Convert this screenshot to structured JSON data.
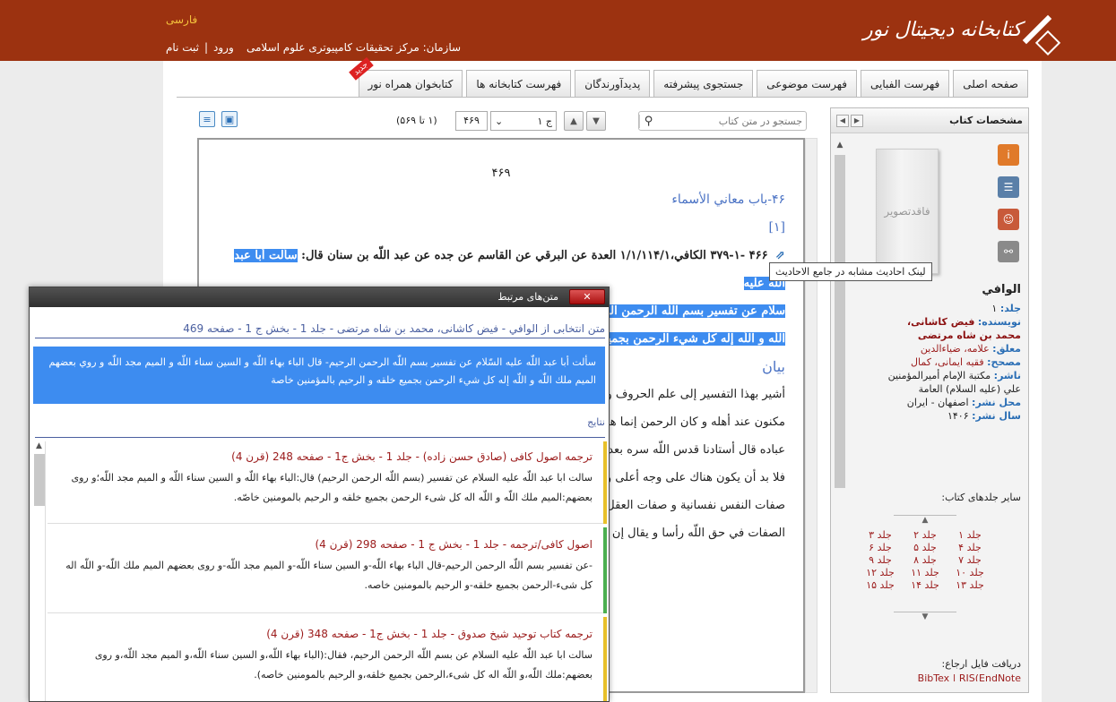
{
  "header": {
    "logo_text": "کتابخانه دیجیتال نور",
    "language_link": "فارسی",
    "organization": "سازمان: مرکز تحقیقات کامپیوتری علوم اسلامی",
    "login": "ورود",
    "separator": "|",
    "register": "ثبت نام",
    "colors": {
      "header_bg": "#9c3210",
      "accent": "#f4c23c"
    }
  },
  "tabs": [
    {
      "label": "صفحه اصلی"
    },
    {
      "label": "فهرست الفبایی"
    },
    {
      "label": "فهرست موضوعی"
    },
    {
      "label": "جستجوی پیشرفته"
    },
    {
      "label": "پدیدآورندگان"
    },
    {
      "label": "فهرست کتابخانه ها"
    },
    {
      "label": "کتابخوان همراه نور",
      "badge": "جدید"
    }
  ],
  "toolbar": {
    "search_placeholder": "جستجو در متن کتاب",
    "volume_select": "ج ۱",
    "page_input": "۴۶۹",
    "page_of": "(۱ تا ۵۶۹)"
  },
  "book_text": {
    "page_number": "۴۶۹",
    "chapter_title": "۴۶-باب معاني الأسماء",
    "section_num": "[۱]",
    "hadith_ref": "۴۶۶ -۳۷۹-۱ الكافي،۱/۱/۱۱۴/۱ العدة عن البرقي عن القاسم عن جده عن عبد اللّه بن سنان قال:",
    "hadith_hl1": "سألت أبا عبد اللّه عليه",
    "hadith_hl2": "سلام عن تفسير بسم اللّه الرحمن الرحيم- قال الباء بهاء اللّه و السين سناء اللّه و الميم مجد اللّه و روي بعضهم الميم ملك",
    "hadith_hl3": "اللّه و اللّه إله كل شي‌ء الرحمن بجميع خلقه و الرحيم بالمؤمنين خاصة",
    "bayan": "بيان",
    "lines": [
      "أشير بهذا التفسير إلى علم الحروف و أن لكل حرف دلالة على شيء و قد اختص به من",
      "مكنون عند أهله و كان الرحمن إنما هو عام لجميع الخلق و الرحيم بالمؤمنين خاصة من",
      "عباده قال أستادنا قدس اللّه سره بعد كلام له في هذا المعنى",
      "فلا بد أن يكون هناك على وجه أعلى و أشرف بحيث يليق به",
      "صفات النفس نفسانية و صفات العقل عقلية",
      "الصفات في حق اللّه رأسا و يقال إن أسماءه الحسنى"
    ]
  },
  "tooltip": "لینک احادیث مشابه در جامع الاحادیث",
  "side": {
    "title": "مشخصات کتاب",
    "cover_text": "فاقدتصویر",
    "book_title": "الوافي",
    "volume_label": "جلد:",
    "volume": "۱",
    "author_label": "نویسنده:",
    "author": "فیض کاشانی، محمد بن شاه مرتضی",
    "annotator_label": "معلق:",
    "annotator": "علامه، ضیاءالدین",
    "editor_label": "مصحح:",
    "editor": "فقیه ایمانی، کمال",
    "publisher_label": "ناشر:",
    "publisher": "مکتبة الإمام أمیرالمؤمنین علي (علیه السلام) العامة",
    "place_label": "محل نشر:",
    "place": "اصفهان - ایران",
    "year_label": "سال نشر:",
    "year": "۱۴۰۶",
    "other_volumes_label": "سایر جلدهای کتاب:",
    "volumes": [
      "جلد ۱",
      "جلد ۲",
      "جلد ۳",
      "جلد ۴",
      "جلد ۵",
      "جلد ۶",
      "جلد ۷",
      "جلد ۸",
      "جلد ۹",
      "جلد ۱۰",
      "جلد ۱۱",
      "جلد ۱۲",
      "جلد ۱۳",
      "جلد ۱۴",
      "جلد ۱۵"
    ],
    "download_label": "دریافت فایل ارجاع:",
    "download_links": "BibTex | RIS(EndNote"
  },
  "dialog": {
    "title": "متن‌های مرتبط",
    "close": "✕",
    "source": "متن انتخابی از الوافي - فیض کاشانی، محمد بن شاه مرتضی - جلد 1 - بخش ج 1 - صفحه 469",
    "quote": "سألت أبا عبد اللّه عليه السّلام عن تفسير بسم اللّه الرحمن الرحيم- قال الباء بهاء اللّه و السين سناء اللّه و الميم مجد اللّه و روي بعضهم الميم ملك اللّه و اللّه إله كل شيء الرحمن بجميع خلقه و الرحيم بالمؤمنين خاصة",
    "results_label": "نتایج",
    "results": [
      {
        "title": "ترجمه اصول کافی (صادق حسن زاده) - جلد 1 - بخش ج1 - صفحه 248 (قرن 4)",
        "text": "سالت ابا عبد اللّه عليه السلام عن تفسير (بسم اللّه الرحمن الرحيم) قال:الباء بهاء اللّه و السين سناء اللّه و الميم مجد اللّه؛و روى بعضهم:الميم ملك اللّه و اللّه اله كل شى‌ء الرحمن بجميع خلقه و الرحيم بالمومنين خاصّه.",
        "color": "#e8c02a"
      },
      {
        "title": "اصول کافی/ترجمه - جلد 1 - بخش ج 1 - صفحه 298 (قرن 4)",
        "text": "-عن تفسير بسم اللّه الرحمن الرحيم-قال الباء بهاء اللّه-و السين سناء اللّه-و الميم مجد اللّه-و روى بعضهم الميم ملك اللّه-و اللّه اله كل شى‌ء-الرحمن بجميع خلقه-و الرحيم بالمومنين خاصه.",
        "color": "#4caf50"
      },
      {
        "title": "ترجمه کتاب توحید شیخ صدوق - جلد 1 - بخش ج1 - صفحه 348 (قرن 4)",
        "text": "سالت ابا عبد اللّه عليه السلام عن بسم اللّه الرحمن الرحيم، فقال:(الباء بهاء اللّه،و السين سناء اللّه،و الميم مجد اللّه،و روى بعضهم:ملك اللّه،و اللّه اله كل شى‌ء،الرحمن بجميع خلقه،و الرحيم بالمومنين خاصه).",
        "color": "#e8c02a"
      }
    ]
  }
}
